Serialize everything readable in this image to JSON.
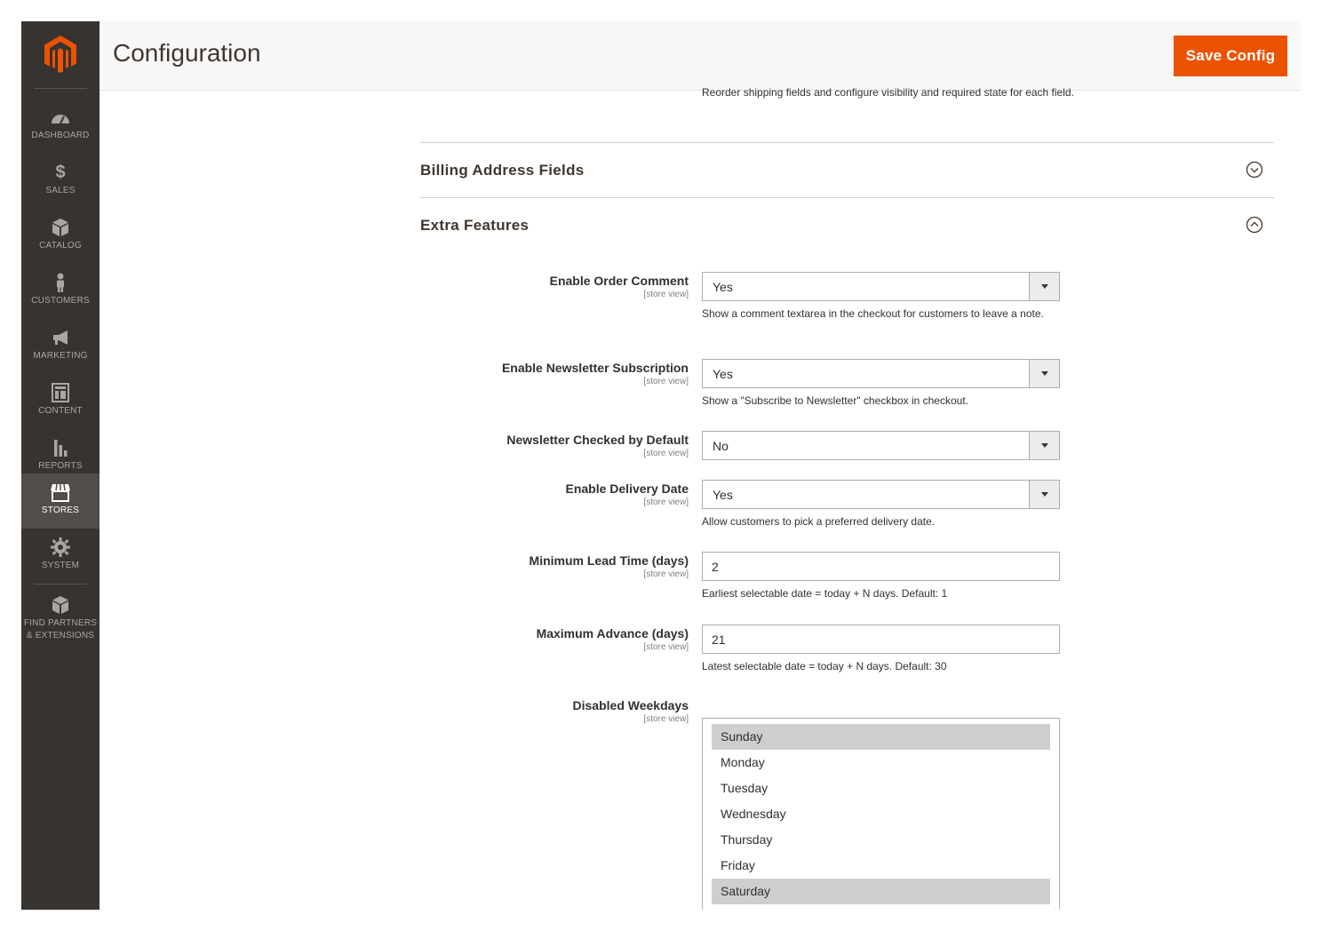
{
  "header": {
    "title": "Configuration",
    "save_label": "Save Config"
  },
  "sidebar": {
    "items": [
      {
        "label": "DASHBOARD",
        "icon": "dashboard-icon"
      },
      {
        "label": "$",
        "icon": "dollar-icon"
      },
      {
        "label": "SALES",
        "icon": "dollar-icon"
      },
      {
        "label": "CATALOG",
        "icon": "cube-icon"
      },
      {
        "label": "CUSTOMERS",
        "icon": "person-icon"
      },
      {
        "label": "MARKETING",
        "icon": "megaphone-icon"
      },
      {
        "label": "CONTENT",
        "icon": "layout-icon"
      },
      {
        "label": "REPORTS",
        "icon": "bar-chart-icon"
      },
      {
        "label": "STORES",
        "icon": "store-icon",
        "active": true
      },
      {
        "label": "SYSTEM",
        "icon": "gear-icon"
      },
      {
        "label": "FIND PARTNERS & EXTENSIONS",
        "icon": "boxes-icon"
      }
    ],
    "partners_line1": "FIND PARTNERS",
    "partners_line2": "& EXTENSIONS"
  },
  "content": {
    "top_note": "Reorder shipping fields and configure visibility and required state for each field.",
    "sections": [
      {
        "title": "Billing Address Fields",
        "state": "collapsed"
      },
      {
        "title": "Extra Features",
        "state": "expanded"
      }
    ],
    "scope_label": "[store view]",
    "fields": {
      "order_comment": {
        "label": "Enable Order Comment",
        "value": "Yes",
        "note": "Show a comment textarea in the checkout for customers to leave a note."
      },
      "newsletter": {
        "label": "Enable Newsletter Subscription",
        "value": "Yes",
        "note": "Show a \"Subscribe to Newsletter\" checkbox in checkout."
      },
      "newsletter_default": {
        "label": "Newsletter Checked by Default",
        "value": "No"
      },
      "delivery_date": {
        "label": "Enable Delivery Date",
        "value": "Yes",
        "note": "Allow customers to pick a preferred delivery date."
      },
      "min_lead": {
        "label": "Minimum Lead Time (days)",
        "value": "2",
        "note": "Earliest selectable date = today + N days. Default: 1"
      },
      "max_advance": {
        "label": "Maximum Advance (days)",
        "value": "21",
        "note": "Latest selectable date = today + N days. Default: 30"
      },
      "disabled_weekdays": {
        "label": "Disabled Weekdays",
        "options": [
          "Sunday",
          "Monday",
          "Tuesday",
          "Wednesday",
          "Thursday",
          "Friday",
          "Saturday"
        ],
        "selected": [
          "Sunday",
          "Saturday"
        ]
      }
    }
  },
  "colors": {
    "accent": "#eb5202",
    "sidebar": "#373330",
    "sidebar_active": "#524d49",
    "selected_option": "#cecece"
  }
}
